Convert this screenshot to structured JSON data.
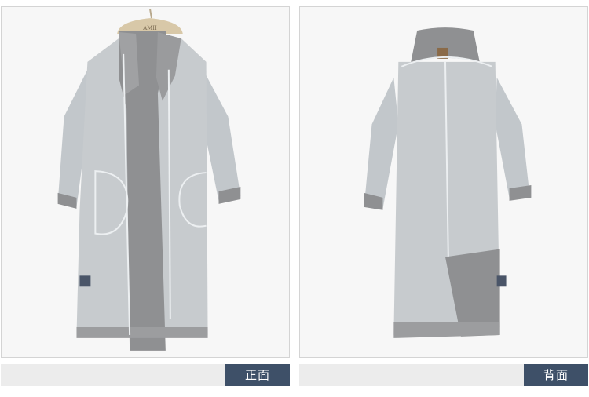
{
  "front": {
    "caption": "正面",
    "hanger_brand": "AMII"
  },
  "back": {
    "caption": "背面"
  },
  "colors": {
    "coat_light": "#c4c9cd",
    "coat_panel": "#8f9092",
    "piping": "#e9ecee",
    "caption_bg": "#3e5068",
    "caption_bar": "#ececec",
    "strap": "#4a5568"
  }
}
